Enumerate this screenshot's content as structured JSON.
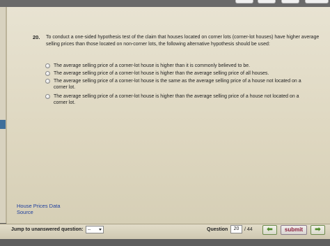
{
  "question": {
    "number": "20.",
    "text": "To conduct a one-sided hypothesis test of the claim that houses located on corner lots (corner-lot houses) have higher average selling prices than those located on non-corner lots, the following alternative hypothesis should be used:",
    "options": [
      "The average selling price of a corner-lot house is higher than it is commonly believed to be.",
      "The average selling price of a corner-lot house is higher than the average selling price of all houses.",
      "The average selling price of a corner-lot house is the same as the average selling price of a house not located on a corner lot.",
      "The average selling price of a corner-lot house is higher than the average selling price of a house not located on a corner lot."
    ]
  },
  "links": {
    "data": "House Prices Data",
    "source": "Source"
  },
  "bottom": {
    "jump_label": "Jump to unanswered question:",
    "jump_value": "--",
    "question_label": "Question",
    "current": "20",
    "total": "/ 44",
    "prev_icon": "left-arrow-icon",
    "next_icon": "right-arrow-icon",
    "prev_glyph": "⬅",
    "next_glyph": "➡",
    "submit_label": "submit"
  },
  "colors": {
    "panel": "#e2dcc9",
    "link": "#1f3f9e",
    "submit_text": "#8a1e3a",
    "nav_arrow": "#4f8a2a"
  }
}
